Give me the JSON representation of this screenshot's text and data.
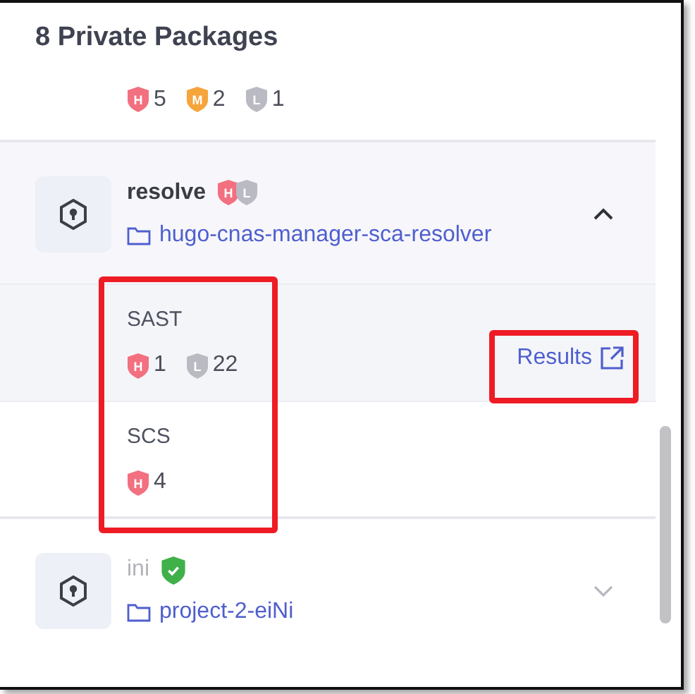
{
  "title": "8 Private Packages",
  "summary": [
    {
      "level": "H",
      "color": "#f2707f",
      "count": "5"
    },
    {
      "level": "M",
      "color": "#f5a53a",
      "count": "2"
    },
    {
      "level": "L",
      "color": "#b9bac2",
      "count": "1"
    }
  ],
  "packages": [
    {
      "name": "resolve",
      "muted": false,
      "expanded": true,
      "badges": [
        {
          "kind": "letter",
          "level": "H",
          "color": "#f2707f"
        },
        {
          "kind": "letter",
          "level": "L",
          "color": "#b9bac2"
        }
      ],
      "project": "hugo-cnas-manager-sca-resolver",
      "details_highlighted": true,
      "details": [
        {
          "label": "SAST",
          "counts": [
            {
              "level": "H",
              "color": "#f2707f",
              "count": "1"
            },
            {
              "level": "L",
              "color": "#b9bac2",
              "count": "22"
            }
          ],
          "link": "Results",
          "link_highlighted": true
        },
        {
          "label": "SCS",
          "counts": [
            {
              "level": "H",
              "color": "#f2707f",
              "count": "4"
            }
          ]
        }
      ]
    },
    {
      "name": "ini",
      "muted": true,
      "expanded": false,
      "badges": [
        {
          "kind": "check",
          "color": "#3fb04a"
        }
      ],
      "project": "project-2-eiNi"
    }
  ]
}
